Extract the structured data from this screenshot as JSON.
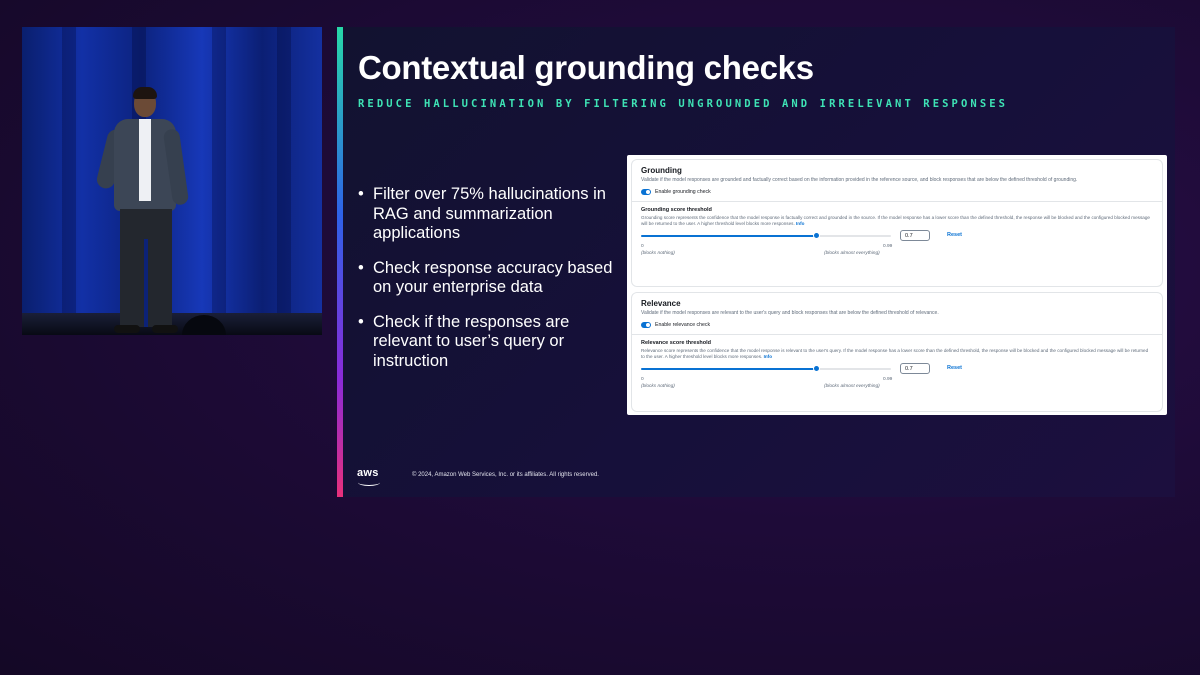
{
  "slide": {
    "title": "Contextual grounding checks",
    "subtitle": "REDUCE HALLUCINATION BY FILTERING UNGROUNDED AND IRRELEVANT RESPONSES",
    "bullets": [
      "Filter over 75% hallucinations in RAG and summarization applications",
      "Check response accuracy based on your enterprise data",
      "Check if the responses are relevant to user’s query or instruction"
    ],
    "bullet_glyph": "•",
    "footer": {
      "logo_text": "aws",
      "copyright": "© 2024, Amazon Web Services, Inc. or its affiliates. All rights reserved."
    }
  },
  "console": {
    "grounding": {
      "title": "Grounding",
      "description": "Validate if the model responses are grounded and factually correct based on the information provided in the reference source, and block responses that are below the defined threshold of grounding.",
      "toggle_label": "Enable grounding check",
      "enabled": true,
      "threshold_label": "Grounding score threshold",
      "threshold_description": "Grounding score represents the confidence that the model response is factually correct and grounded in the source. If the model response has a lower score than the defined threshold, the response will be blocked and the configured blocked message will be returned to the user. A higher threshold level blocks more responses.",
      "info_link": "Info",
      "value": "0.7",
      "slider_fraction": 0.7,
      "min": "0",
      "max": "0.99",
      "min_label": "(blocks nothing)",
      "max_label": "(blocks almost everything)",
      "reset_label": "Reset"
    },
    "relevance": {
      "title": "Relevance",
      "description": "Validate if the model responses are relevant to the user's query and block responses that are below the defined threshold of relevance.",
      "toggle_label": "Enable relevance check",
      "enabled": true,
      "threshold_label": "Relevance score threshold",
      "threshold_description": "Relevance score represents the confidence that the model response is relevant to the user's query. If the model response has a lower score than the defined threshold, the response will be blocked and the configured blocked message will be returned to the user. A higher threshold level blocks more responses.",
      "info_link": "Info",
      "value": "0.7",
      "slider_fraction": 0.7,
      "min": "0",
      "max": "0.99",
      "min_label": "(blocks nothing)",
      "max_label": "(blocks almost everything)",
      "reset_label": "Reset"
    }
  },
  "colors": {
    "subtitle": "#3ee3b5",
    "console_accent": "#0972d3",
    "background": "#1e0b38"
  }
}
